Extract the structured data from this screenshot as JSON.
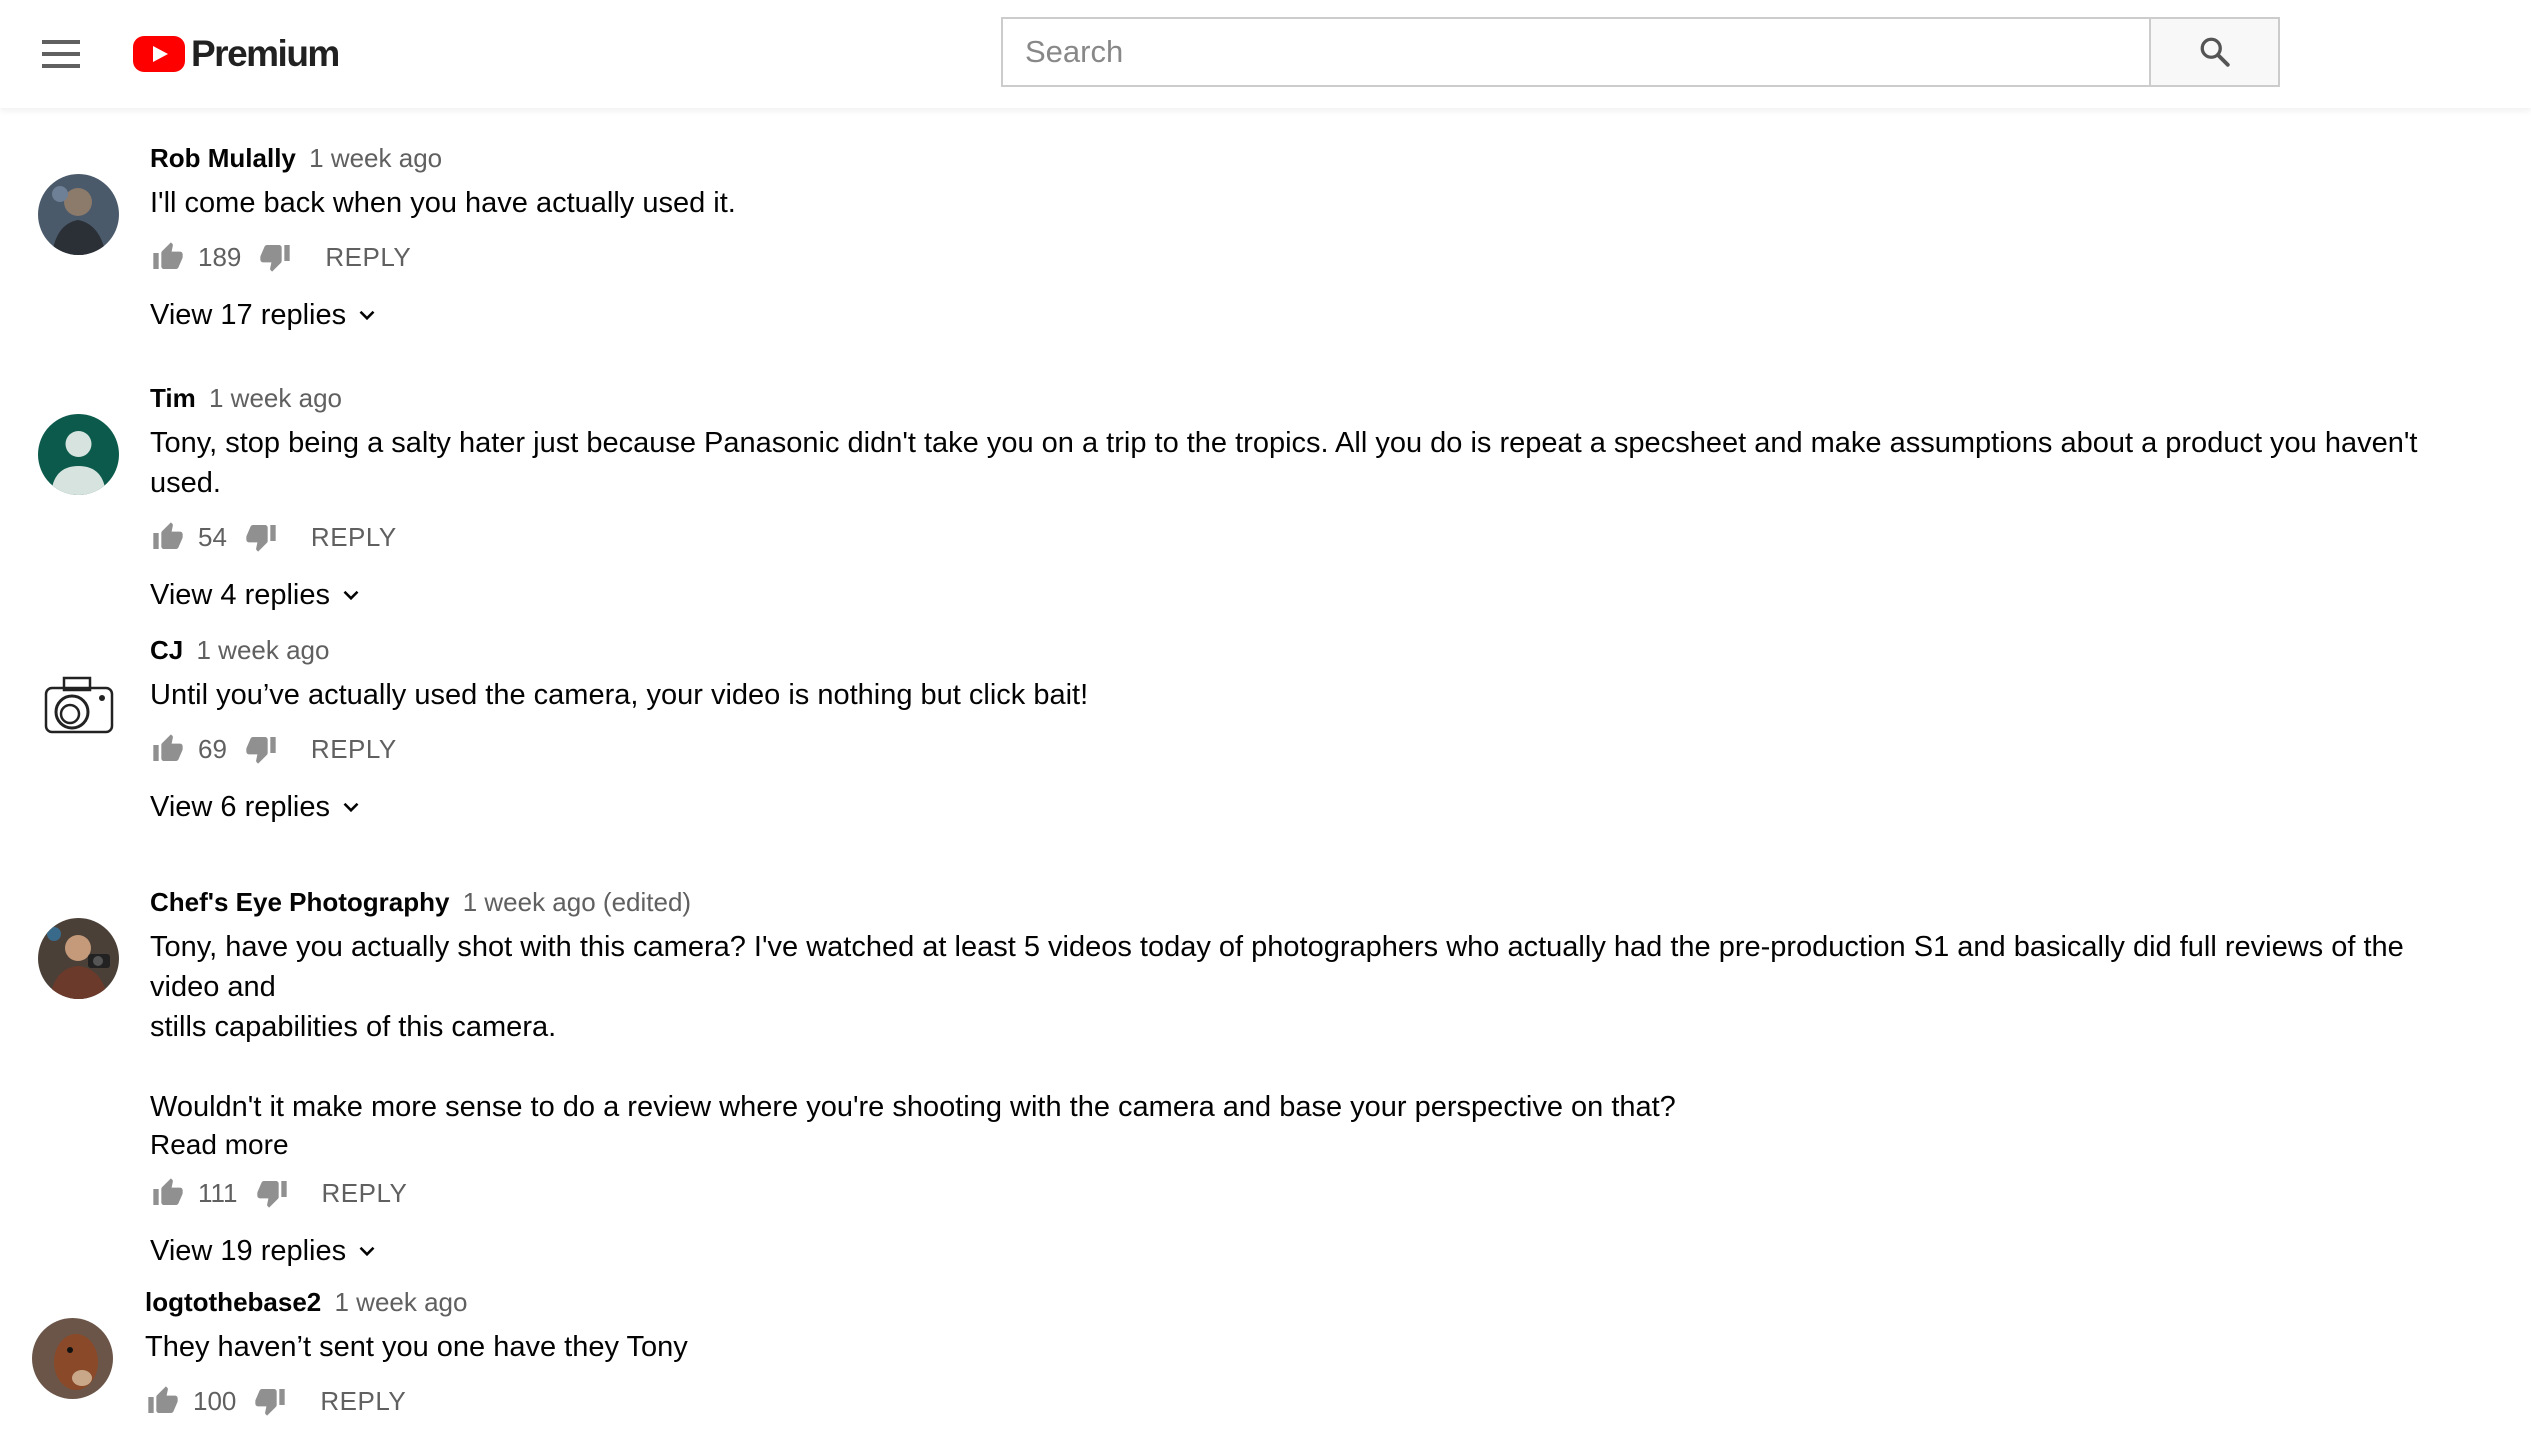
{
  "header": {
    "logo_text": "Premium",
    "search": {
      "placeholder": "Search",
      "value": ""
    }
  },
  "comments": [
    {
      "author": "Rob Mulally",
      "time": "1 week ago",
      "text": "I'll come back when you have actually used it.",
      "likes": "189",
      "reply_label": "REPLY",
      "view_replies": "View 17 replies",
      "avatar_color": "#3b4a5c"
    },
    {
      "author": "Tim",
      "time": "1 week ago",
      "text": "Tony, stop being a salty hater just because Panasonic didn't take you on a trip to the tropics. All you do is repeat a specsheet and make assumptions about a product you haven't used.",
      "likes": "54",
      "reply_label": "REPLY",
      "view_replies": "View 4 replies",
      "avatar_color": "#0b5a4c"
    },
    {
      "author": "CJ",
      "time": "1 week ago",
      "text": "Until you’ve actually used the camera, your video is nothing but click bait!",
      "likes": "69",
      "reply_label": "REPLY",
      "view_replies": "View 6 replies",
      "avatar_color": "#ffffff"
    },
    {
      "author": "Chef's Eye Photography",
      "time": "1 week ago (edited)",
      "text_lines": [
        "Tony, have you actually shot with this camera? I've watched at least 5 videos today of photographers who actually had the pre-production S1 and basically did full reviews of the video and",
        "stills capabilities of this camera.",
        "",
        "Wouldn't it make more sense to do a review where you're shooting with the camera and base your perspective on that?"
      ],
      "read_more": "Read more",
      "likes": "111",
      "reply_label": "REPLY",
      "view_replies": "View 19 replies",
      "avatar_color": "#5a4a3e"
    },
    {
      "author": "logtothebase2",
      "time": "1 week ago",
      "text": "They haven’t sent you one have they Tony",
      "likes": "100",
      "reply_label": "REPLY",
      "avatar_color": "#7a4a2e"
    }
  ],
  "icons": {
    "menu": "hamburger-menu-icon",
    "search": "search-icon",
    "like": "thumbs-up-icon",
    "dislike": "thumbs-down-icon",
    "expand": "chevron-down-icon"
  },
  "colors": {
    "brand_red": "#ff0000",
    "text_primary": "#030303",
    "text_secondary": "#606060"
  }
}
